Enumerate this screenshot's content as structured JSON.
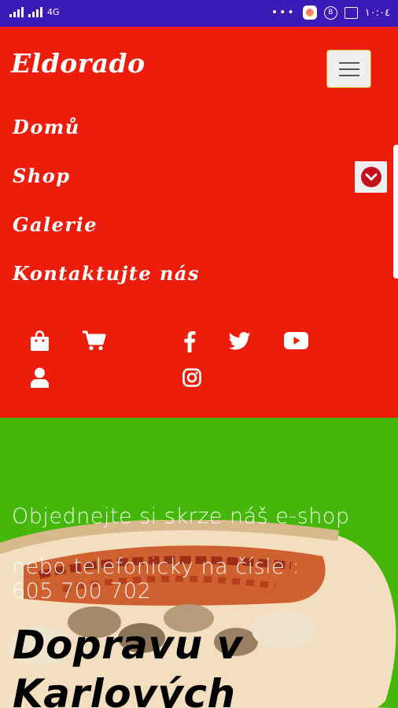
{
  "status_bar": {
    "signal_text": "4G",
    "clock": "١٠:٠٤",
    "background": "#3a1bb7"
  },
  "navbar": {
    "brand": "Eldorado",
    "toggler_icon": "hamburger-icon",
    "items": [
      {
        "label": "Domů"
      },
      {
        "label": "Shop",
        "dropdown_icon": "chevron-down-icon"
      },
      {
        "label": "Galerie"
      },
      {
        "label": "Kontaktujte nás"
      }
    ],
    "action_icons": [
      "shopping-bag-icon",
      "cart-icon",
      "user-icon"
    ],
    "social_icons": [
      "facebook-icon",
      "twitter-icon",
      "youtube-icon",
      "instagram-icon"
    ],
    "background": "#ee1d0b"
  },
  "hero": {
    "line1": "Objednejte si skrze náš e-shop",
    "line2": "nebo telefonicky na čísle :",
    "line3": "605 700 702",
    "title_line1": "Dopravu v",
    "title_line2": "Karlových",
    "background": "#45b70b"
  }
}
